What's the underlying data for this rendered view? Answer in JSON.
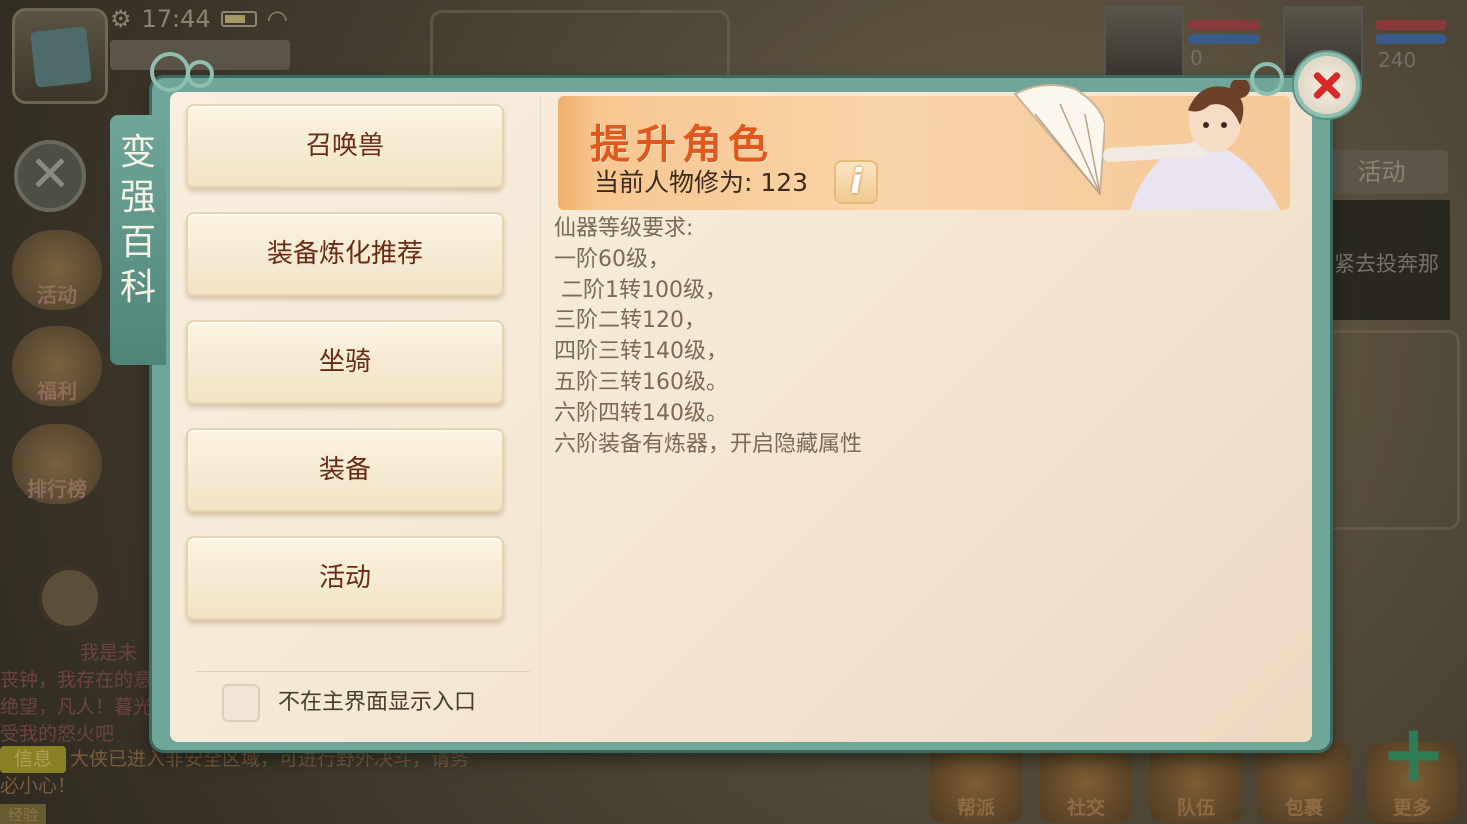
{
  "status": {
    "time": "17:44"
  },
  "player": {
    "name": ""
  },
  "portraits": [
    {
      "value": "0"
    },
    {
      "value": "240"
    }
  ],
  "left_icons": [
    {
      "label": "活动",
      "icon": "horn-icon"
    },
    {
      "label": "福利",
      "icon": "gift-girl-icon"
    },
    {
      "label": "排行榜",
      "icon": "ranking-icon"
    }
  ],
  "right_tab": {
    "label": "活动"
  },
  "right_panel": {
    "text": "赶紧去投奔那"
  },
  "chat": {
    "lines": [
      "我是未",
      "丧钟，我存在的意",
      "绝望，凡人！暮光",
      "受我的怒火吧"
    ],
    "system_tag": "信息",
    "system_text": "大侠已进入非安全区域，可进行野外决斗，请务必小心！",
    "bottom_label": "经验"
  },
  "bottom_bar": [
    {
      "label": "帮派"
    },
    {
      "label": "社交"
    },
    {
      "label": "队伍"
    },
    {
      "label": "包裹"
    },
    {
      "label": "更多"
    }
  ],
  "dialog": {
    "side_tab_title": "变强百科",
    "menu": [
      "召唤兽",
      "装备炼化推荐",
      "坐骑",
      "装备",
      "活动"
    ],
    "checkbox_label": "不在主界面显示入口",
    "banner": {
      "title": "提升角色",
      "cultivation_label": "当前人物修为: 123",
      "info_icon_label": "i"
    },
    "content": [
      "仙器等级要求:",
      "一阶60级，",
      " 二阶1转100级，",
      "三阶二转120，",
      "四阶三转140级，",
      "五阶三转160级。",
      "六阶四转140级。",
      "六阶装备有炼器，开启隐藏属性"
    ]
  },
  "colors": {
    "frame": "#6fa69a",
    "menu_text": "#6b2a14",
    "banner_title": "#e0581c",
    "close_x": "#d62a2a"
  }
}
